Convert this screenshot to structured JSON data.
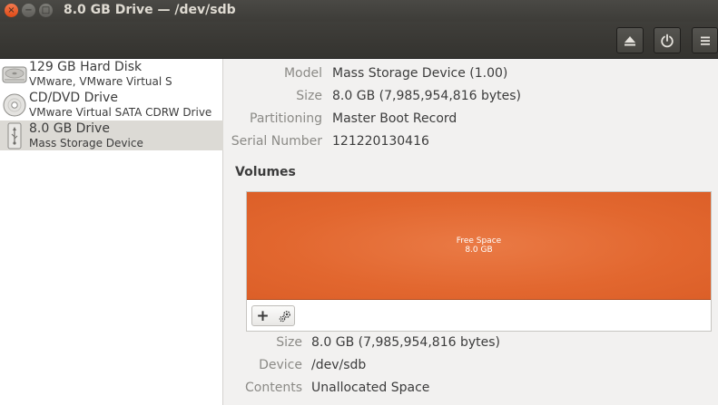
{
  "window": {
    "title": "8.0 GB Drive — /dev/sdb",
    "close_glyph": "×",
    "minimize_glyph": "−",
    "maximize_glyph": "□"
  },
  "header": {
    "buttons": [
      {
        "name": "eject",
        "icon": "eject-icon"
      },
      {
        "name": "power",
        "icon": "power-icon"
      },
      {
        "name": "menu",
        "icon": "hamburger-menu-icon"
      }
    ]
  },
  "sidebar": {
    "drives": [
      {
        "name": "129 GB Hard Disk",
        "subtitle": "VMware, VMware Virtual S",
        "icon": "hard-disk-icon",
        "selected": false
      },
      {
        "name": "CD/DVD Drive",
        "subtitle": "VMware Virtual SATA CDRW Drive",
        "icon": "optical-disc-icon",
        "selected": false
      },
      {
        "name": "8.0 GB Drive",
        "subtitle": "Mass Storage Device",
        "icon": "usb-drive-icon",
        "selected": true
      }
    ]
  },
  "details": {
    "model_label": "Model",
    "model_value": "Mass Storage Device (1.00)",
    "size_label": "Size",
    "size_value": "8.0 GB (7,985,954,816 bytes)",
    "partitioning_label": "Partitioning",
    "partitioning_value": "Master Boot Record",
    "serial_label": "Serial Number",
    "serial_value": "121220130416"
  },
  "volumes": {
    "heading": "Volumes",
    "block_name": "Free Space",
    "block_size": "8.0 GB",
    "block_color": "#e2672f",
    "add_glyph": "+"
  },
  "volume_details": {
    "size_label": "Size",
    "size_value": "8.0 GB (7,985,954,816 bytes)",
    "device_label": "Device",
    "device_value": "/dev/sdb",
    "contents_label": "Contents",
    "contents_value": "Unallocated Space"
  }
}
